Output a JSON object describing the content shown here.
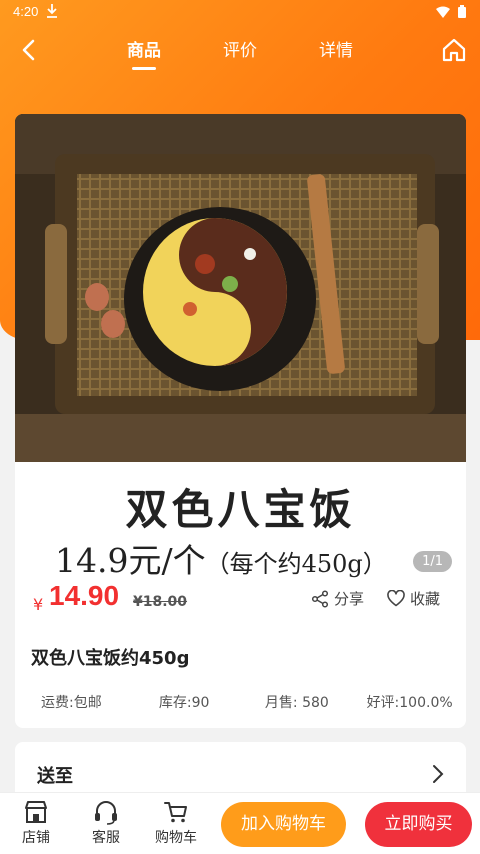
{
  "status": {
    "time": "4:20"
  },
  "nav": {
    "tabs": [
      {
        "label": "商品",
        "active": true
      },
      {
        "label": "评价",
        "active": false
      },
      {
        "label": "详情",
        "active": false
      }
    ]
  },
  "product": {
    "image_caption_title": "双色八宝饭",
    "image_caption_price": "14.9元/个",
    "image_caption_note": "（每个约450g）",
    "pager": "1/1",
    "currency_symbol": "¥",
    "price": "14.90",
    "original_price": "¥18.00",
    "share_label": "分享",
    "favorite_label": "收藏",
    "name": "双色八宝饭约450g",
    "stats": [
      "运费:包邮",
      "库存:90",
      "月售: 580",
      "好评:100.0%"
    ]
  },
  "shipping": {
    "label": "送至"
  },
  "bottom_bar": {
    "store_label": "店铺",
    "service_label": "客服",
    "cart_label": "购物车",
    "add_to_cart": "加入购物车",
    "buy_now": "立即购买"
  },
  "colors": {
    "header_gradient_start": "#ff9a1f",
    "header_gradient_end": "#ff6a0a",
    "price_red": "#f23030",
    "add_cart_orange": "#ff9c1a",
    "buy_red": "#f0313c"
  },
  "icons": [
    "download-icon",
    "wifi-icon",
    "battery-icon",
    "back-icon",
    "home-icon",
    "share-icon",
    "heart-icon",
    "chevron-right-icon",
    "store-icon",
    "headset-icon",
    "cart-icon"
  ]
}
